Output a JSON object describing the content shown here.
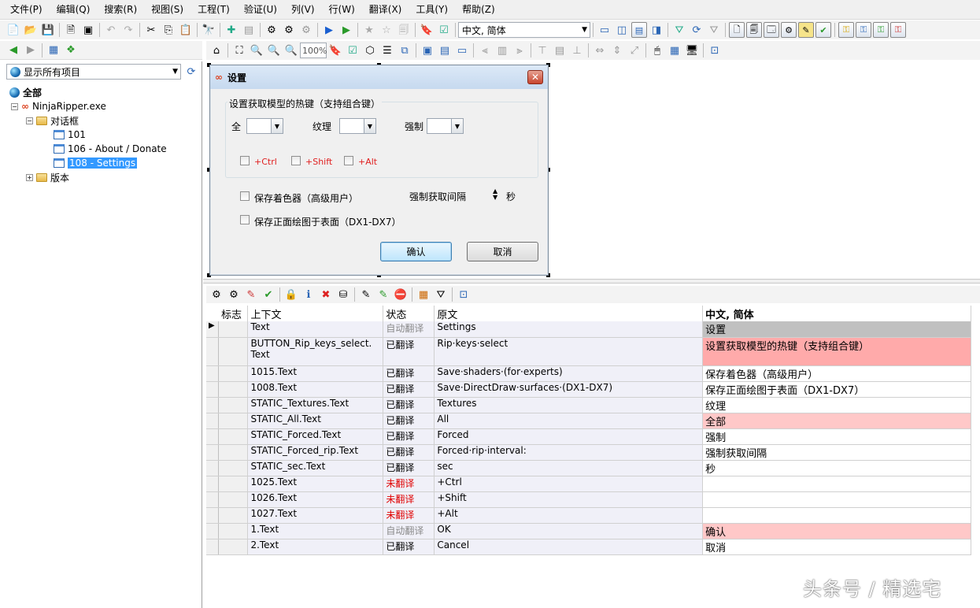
{
  "menu": [
    "文件(P)",
    "编辑(Q)",
    "搜索(R)",
    "视图(S)",
    "工程(T)",
    "验证(U)",
    "列(V)",
    "行(W)",
    "翻译(X)",
    "工具(Y)",
    "帮助(Z)"
  ],
  "toolbar": {
    "language_combo": "中文, 简体",
    "zoom": "100%"
  },
  "left": {
    "filter_combo": "显示所有项目"
  },
  "tree": {
    "root": "全部",
    "exe": "NinjaRipper.exe",
    "dialogs": "对话框",
    "d1": "101",
    "d2": "106 - About / Donate",
    "d3": "108 - Settings",
    "version": "版本"
  },
  "dialog": {
    "title": "设置",
    "close": "✕",
    "group_label": "设置获取模型的热键（支持组合键）",
    "all_label": "全",
    "textures_label": "纹理",
    "forced_label": "强制",
    "ctrl": "+Ctrl",
    "shift": "+Shift",
    "alt": "+Alt",
    "save_shaders": "保存着色器（高级用户）",
    "interval_label": "强制获取间隔",
    "sec": "秒",
    "save_surfaces": "保存正面绘图于表面（DX1-DX7）",
    "ok": "确认",
    "cancel": "取消"
  },
  "grid": {
    "headers": [
      "标志",
      "上下文",
      "状态",
      "原文",
      "中文, 简体"
    ],
    "rows": [
      {
        "context": "Text",
        "status": "自动翻译",
        "status_kind": "auto",
        "source": "Settings",
        "translation": "设置",
        "tr_style": "gray"
      },
      {
        "context": "BUTTON_Rip_keys_select.\nText",
        "status": "已翻译",
        "status_kind": "done",
        "source": "Rip·keys·select",
        "translation": "设置获取模型的热键（支持组合键）",
        "tr_style": "pink2"
      },
      {
        "context": "1015.Text",
        "status": "已翻译",
        "status_kind": "done",
        "source": "Save·shaders·(for·experts)",
        "translation": "保存着色器（高级用户）",
        "tr_style": "white"
      },
      {
        "context": "1008.Text",
        "status": "已翻译",
        "status_kind": "done",
        "source": "Save·DirectDraw·surfaces·(DX1-DX7)",
        "translation": "保存正面绘图于表面（DX1-DX7）",
        "tr_style": "white"
      },
      {
        "context": "STATIC_Textures.Text",
        "status": "已翻译",
        "status_kind": "done",
        "source": "Textures",
        "translation": "纹理",
        "tr_style": "white"
      },
      {
        "context": "STATIC_All.Text",
        "status": "已翻译",
        "status_kind": "done",
        "source": "All",
        "translation": "全部",
        "tr_style": "pink"
      },
      {
        "context": "STATIC_Forced.Text",
        "status": "已翻译",
        "status_kind": "done",
        "source": "Forced",
        "translation": "强制",
        "tr_style": "white"
      },
      {
        "context": "STATIC_Forced_rip.Text",
        "status": "已翻译",
        "status_kind": "done",
        "source": "Forced·rip·interval:",
        "translation": "强制获取间隔",
        "tr_style": "white"
      },
      {
        "context": "STATIC_sec.Text",
        "status": "已翻译",
        "status_kind": "done",
        "source": "sec",
        "translation": "秒",
        "tr_style": "white"
      },
      {
        "context": "1025.Text",
        "status": "未翻译",
        "status_kind": "not",
        "source": "+Ctrl",
        "translation": "",
        "tr_style": "white"
      },
      {
        "context": "1026.Text",
        "status": "未翻译",
        "status_kind": "not",
        "source": "+Shift",
        "translation": "",
        "tr_style": "white"
      },
      {
        "context": "1027.Text",
        "status": "未翻译",
        "status_kind": "not",
        "source": "+Alt",
        "translation": "",
        "tr_style": "white"
      },
      {
        "context": "1.Text",
        "status": "自动翻译",
        "status_kind": "auto",
        "source": "OK",
        "translation": "确认",
        "tr_style": "pink"
      },
      {
        "context": "2.Text",
        "status": "已翻译",
        "status_kind": "done",
        "source": "Cancel",
        "translation": "取消",
        "tr_style": "white"
      }
    ]
  },
  "watermark": "头条号 / 精选宅"
}
